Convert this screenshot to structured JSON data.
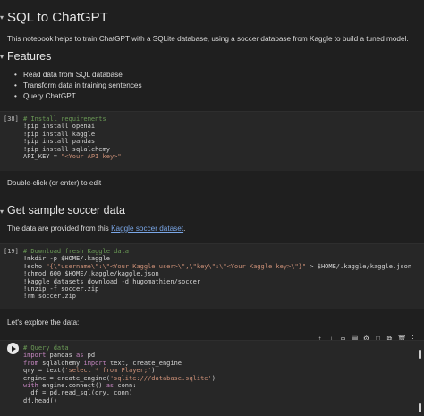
{
  "section1": {
    "title": "SQL to ChatGPT",
    "description": "This notebook helps to train ChatGPT with a SQLite database, using a soccer database from Kaggle to build a tuned model."
  },
  "features": {
    "title": "Features",
    "items": [
      "Read data from SQL database",
      "Transform data in training sentences",
      "Query ChatGPT"
    ]
  },
  "cell1": {
    "prompt": "[38]",
    "lines": [
      "# Install requirements",
      "!pip install openai",
      "!pip install kaggle",
      "!pip install pandas",
      "!pip install sqlalchemy",
      "API_KEY = ",
      "\"<Your API key>\""
    ]
  },
  "edit_hint": "Double-click (or enter) to edit",
  "section2": {
    "title": "Get sample soccer data",
    "text_before": "The data are provided from this ",
    "link": "Kaggle soccer dataset",
    "text_after": "."
  },
  "cell2": {
    "prompt": "[19]",
    "lines": [
      "# Download fresh Kaggle data",
      "!mkdir -p $HOME/.kaggle",
      "!echo ",
      "\"{\\\"username\\\":\\\"<Your Kaggle user>\\\",\\\"key\\\":\\\"<Your Kaggle key>\\\"}\"",
      " > $HOME/.kaggle/kaggle.json",
      "!chmod 600 $HOME/.kaggle/kaggle.json",
      "!kaggle datasets download -d hugomathien/soccer",
      "!unzip -f soccer.zip",
      "!rm soccer.zip"
    ]
  },
  "explore_text": "Let's explore the data:",
  "cell3": {
    "lines": [
      "# Query data",
      "import",
      " pandas ",
      "as",
      " pd",
      "from",
      " sqlalchemy ",
      "import",
      " text, create_engine",
      "qry = text(",
      "'select * from Player;'",
      ")",
      "engine = create_engine(",
      "'sqlite:///database.sqlite'",
      ")",
      "with",
      " engine.connect() ",
      "as",
      " conn:",
      "  df = pd.read_sql(qry, conn)",
      "df.head()"
    ]
  },
  "toolbar_icons": [
    "arrow-up-icon",
    "arrow-down-icon",
    "link-icon",
    "comment-icon",
    "settings-icon",
    "expand-icon",
    "copy-icon",
    "delete-icon",
    "more-icon"
  ]
}
